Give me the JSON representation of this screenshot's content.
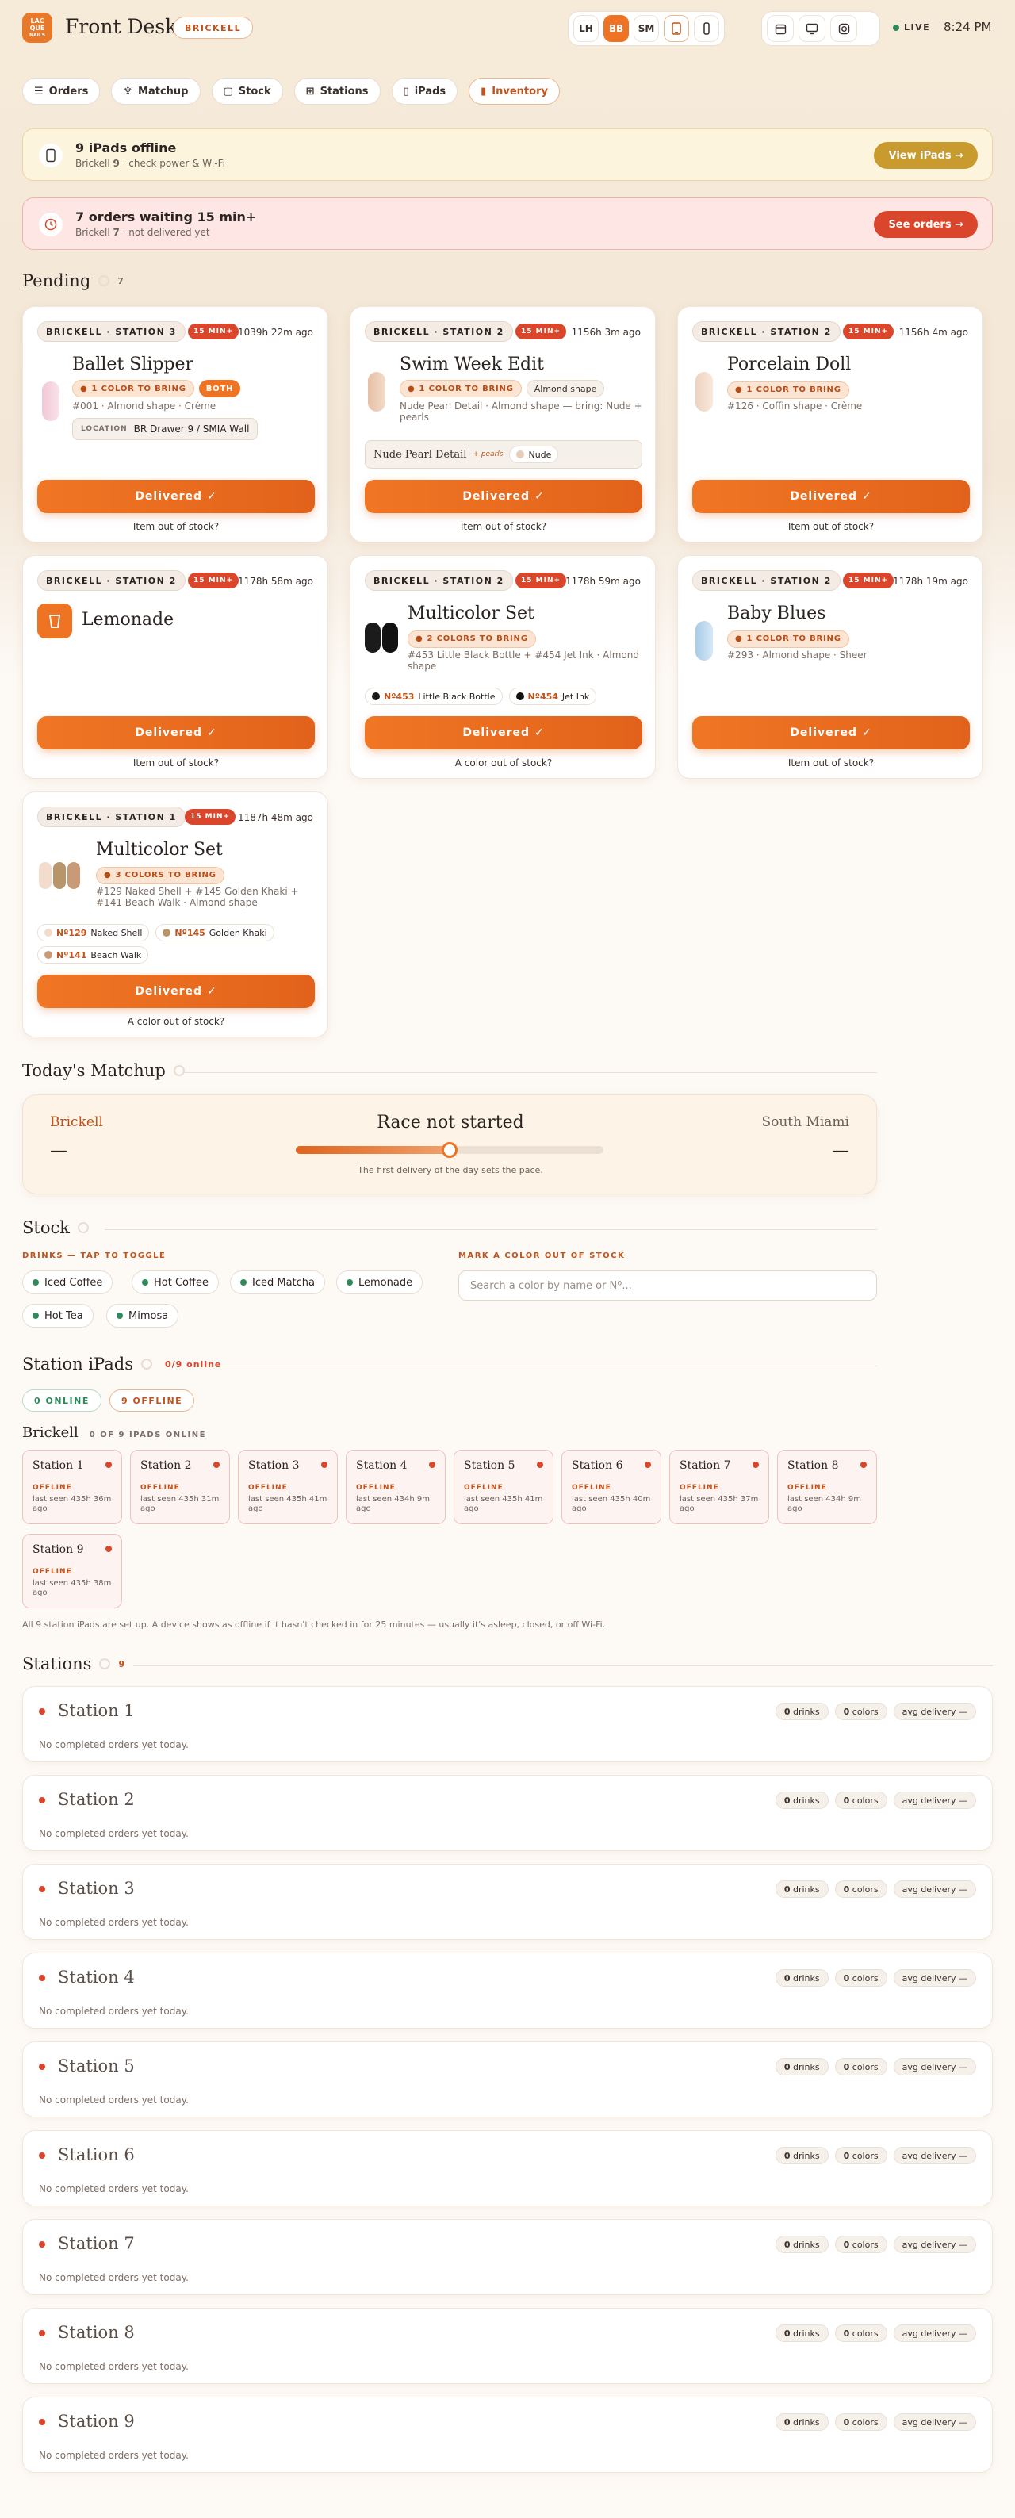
{
  "header": {
    "logo_lines": [
      "LAC",
      "QUE",
      "NAILS"
    ],
    "title": "Front Desk",
    "location": "BRICKELL",
    "locations": [
      "LH",
      "BB",
      "SM"
    ],
    "active_location": "BB",
    "live": "LIVE",
    "time": "8:24 PM",
    "icons": [
      "ipad-icon",
      "iphone-icon",
      "calendar-icon",
      "monitor-icon",
      "instagram-icon"
    ]
  },
  "nav": [
    "Orders",
    "Matchup",
    "Stock",
    "Stations",
    "iPads",
    "Inventory"
  ],
  "alerts": {
    "ipads": {
      "title": "9 iPads offline",
      "sub_pre": "Brickell ",
      "sub_count": "9",
      "sub_post": " · check power & Wi-Fi",
      "button": "View iPads →"
    },
    "orders": {
      "title": "7 orders waiting 15 min+",
      "sub_pre": "Brickell ",
      "sub_count": "7",
      "sub_post": " · not delivered yet",
      "button": "See orders →"
    }
  },
  "pending": {
    "title": "Pending",
    "count": "7",
    "orders": [
      {
        "station": "BRICKELL · STATION 3",
        "late": "15 MIN+",
        "ago": "1039h 22m ago",
        "name": "Ballet Slipper",
        "bring": "1 COLOR TO BRING",
        "both": "BOTH",
        "detail": "#001 · Almond shape · Crème",
        "location_label": "LOCATION",
        "location": "BR Drawer 9 / SMIA Wall",
        "deliver": "Delivered ✓",
        "oos": "Item out of stock?"
      },
      {
        "station": "BRICKELL · STATION 2",
        "late": "15 MIN+",
        "ago": "1156h 3m ago",
        "name": "Swim Week Edit",
        "bring": "1 COLOR TO BRING",
        "shape": "Almond shape",
        "detail": "Nude Pearl Detail · Almond shape — bring: Nude + pearls",
        "extra_label": "Nude Pearl Detail",
        "extra_tag": "+ pearls",
        "extra_chip": "Nude",
        "deliver": "Delivered ✓",
        "oos": "Item out of stock?"
      },
      {
        "station": "BRICKELL · STATION 2",
        "late": "15 MIN+",
        "ago": "1156h 4m ago",
        "name": "Porcelain Doll",
        "bring": "1 COLOR TO BRING",
        "detail": "#126 · Coffin shape · Crème",
        "deliver": "Delivered ✓",
        "oos": "Item out of stock?"
      },
      {
        "station": "BRICKELL · STATION 2",
        "late": "15 MIN+",
        "ago": "1178h 58m ago",
        "name": "Lemonade",
        "deliver": "Delivered ✓",
        "oos": "Item out of stock?"
      },
      {
        "station": "BRICKELL · STATION 2",
        "late": "15 MIN+",
        "ago": "1178h 59m ago",
        "name": "Multicolor Set",
        "bring": "2 COLORS TO BRING",
        "detail": "#453 Little Black Bottle + #454 Jet Ink · Almond shape",
        "chips": [
          {
            "num": "Nº453",
            "name": "Little Black Bottle",
            "color": "#1b1b1b"
          },
          {
            "num": "Nº454",
            "name": "Jet Ink",
            "color": "#121212"
          }
        ],
        "deliver": "Delivered ✓",
        "oos": "A color out of stock?"
      },
      {
        "station": "BRICKELL · STATION 2",
        "late": "15 MIN+",
        "ago": "1178h 19m ago",
        "name": "Baby Blues",
        "bring": "1 COLOR TO BRING",
        "detail": "#293 · Almond shape · Sheer",
        "deliver": "Delivered ✓",
        "oos": "Item out of stock?"
      },
      {
        "station": "BRICKELL · STATION 1",
        "late": "15 MIN+",
        "ago": "1187h 48m ago",
        "name": "Multicolor Set",
        "bring": "3 COLORS TO BRING",
        "detail": "#129 Naked Shell + #145 Golden Khaki + #141 Beach Walk · Almond shape",
        "chips": [
          {
            "num": "Nº129",
            "name": "Naked Shell",
            "color": "#f3dccb"
          },
          {
            "num": "Nº145",
            "name": "Golden Khaki",
            "color": "#b9956a"
          },
          {
            "num": "Nº141",
            "name": "Beach Walk",
            "color": "#c99a78"
          }
        ],
        "deliver": "Delivered ✓",
        "oos": "A color out of stock?"
      }
    ]
  },
  "matchup": {
    "title": "Today's Matchup",
    "left": "Brickell",
    "left_score": "—",
    "center": "Race not started",
    "right": "South Miami",
    "right_score": "—",
    "sub": "The first delivery of the day sets the pace.",
    "progress": 0.5
  },
  "stock": {
    "title": "Stock",
    "drinks_label": "DRINKS — TAP TO TOGGLE",
    "drinks": [
      "Iced Coffee",
      "Hot Coffee",
      "Iced Matcha",
      "Lemonade",
      "Hot Tea",
      "Mimosa"
    ],
    "color_label": "MARK A COLOR OUT OF STOCK",
    "search_placeholder": "Search a color by name or Nº..."
  },
  "ipads": {
    "title": "Station iPads",
    "online_count": "0/9 online",
    "online_tab": "0 ONLINE",
    "offline_tab": "9 OFFLINE",
    "location": "Brickell",
    "location_count": "0 OF 9 IPADS ONLINE",
    "devices": [
      {
        "name": "Station 1",
        "status": "OFFLINE",
        "seen": "last seen 435h 36m ago"
      },
      {
        "name": "Station 2",
        "status": "OFFLINE",
        "seen": "last seen 435h 31m ago"
      },
      {
        "name": "Station 3",
        "status": "OFFLINE",
        "seen": "last seen 435h 41m ago"
      },
      {
        "name": "Station 4",
        "status": "OFFLINE",
        "seen": "last seen 434h 9m ago"
      },
      {
        "name": "Station 5",
        "status": "OFFLINE",
        "seen": "last seen 435h 41m ago"
      },
      {
        "name": "Station 6",
        "status": "OFFLINE",
        "seen": "last seen 435h 40m ago"
      },
      {
        "name": "Station 7",
        "status": "OFFLINE",
        "seen": "last seen 435h 37m ago"
      },
      {
        "name": "Station 8",
        "status": "OFFLINE",
        "seen": "last seen 434h 9m ago"
      },
      {
        "name": "Station 9",
        "status": "OFFLINE",
        "seen": "last seen 435h 38m ago"
      }
    ],
    "note": "All 9 station iPads are set up. A device shows as offline if it hasn't checked in for 25 minutes — usually it's asleep, closed, or off Wi-Fi."
  },
  "stations": {
    "title": "Stations",
    "count": "9",
    "items": [
      {
        "name": "Station 1",
        "empty": "No completed orders yet today.",
        "drinks": "drinks",
        "drinks_n": "0",
        "colors": "colors",
        "colors_n": "0",
        "avg": "avg delivery —"
      },
      {
        "name": "Station 2",
        "empty": "No completed orders yet today.",
        "drinks": "drinks",
        "drinks_n": "0",
        "colors": "colors",
        "colors_n": "0",
        "avg": "avg delivery —"
      },
      {
        "name": "Station 3",
        "empty": "No completed orders yet today.",
        "drinks": "drinks",
        "drinks_n": "0",
        "colors": "colors",
        "colors_n": "0",
        "avg": "avg delivery —"
      },
      {
        "name": "Station 4",
        "empty": "No completed orders yet today.",
        "drinks": "drinks",
        "drinks_n": "0",
        "colors": "colors",
        "colors_n": "0",
        "avg": "avg delivery —"
      },
      {
        "name": "Station 5",
        "empty": "No completed orders yet today.",
        "drinks": "drinks",
        "drinks_n": "0",
        "colors": "colors",
        "colors_n": "0",
        "avg": "avg delivery —"
      },
      {
        "name": "Station 6",
        "empty": "No completed orders yet today.",
        "drinks": "drinks",
        "drinks_n": "0",
        "colors": "colors",
        "colors_n": "0",
        "avg": "avg delivery —"
      },
      {
        "name": "Station 7",
        "empty": "No completed orders yet today.",
        "drinks": "drinks",
        "drinks_n": "0",
        "colors": "colors",
        "colors_n": "0",
        "avg": "avg delivery —"
      },
      {
        "name": "Station 8",
        "empty": "No completed orders yet today.",
        "drinks": "drinks",
        "drinks_n": "0",
        "colors": "colors",
        "colors_n": "0",
        "avg": "avg delivery —"
      },
      {
        "name": "Station 9",
        "empty": "No completed orders yet today.",
        "drinks": "drinks",
        "drinks_n": "0",
        "colors": "colors",
        "colors_n": "0",
        "avg": "avg delivery —"
      }
    ]
  },
  "colors": {
    "accent": "#ee7424",
    "danger": "#d9462b",
    "gold": "#c99a2e",
    "online": "#2e8a5a"
  }
}
